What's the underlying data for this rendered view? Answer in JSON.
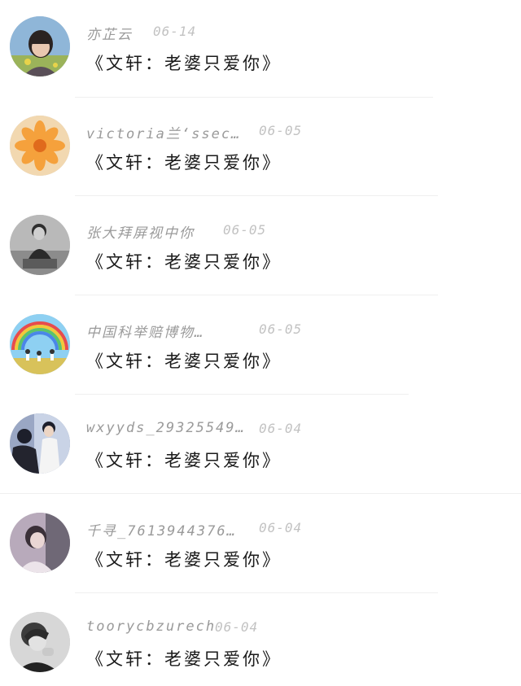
{
  "comments": [
    {
      "username": "亦芷云",
      "date": "06-14",
      "message": "《文轩：老婆只爱你》",
      "avatar": "avatar-girl-short-hair"
    },
    {
      "username": "victoria兰‘ssec…",
      "date": "06-05",
      "message": "《文轩：老婆只爱你》",
      "avatar": "avatar-orange-flower"
    },
    {
      "username": "张大拜屏视中你",
      "date": "06-05",
      "message": "《文轩：老婆只爱你》",
      "avatar": "avatar-bw-man"
    },
    {
      "username": "中国科举赔博物…",
      "date": "06-05",
      "message": "《文轩：老婆只爱你》",
      "avatar": "avatar-rainbow-field"
    },
    {
      "username": "wxyyds_29325549…",
      "date": "06-04",
      "message": "《文轩：老婆只爱你》",
      "avatar": "avatar-two-boys"
    },
    {
      "username": "千寻_7613944376…",
      "date": "06-04",
      "message": "《文轩：老婆只爱你》",
      "avatar": "avatar-purple-girl"
    },
    {
      "username": "toorycbzurech",
      "date": "06-04",
      "message": "《文轩：老婆只爱你》",
      "avatar": "avatar-grey-boy"
    }
  ]
}
